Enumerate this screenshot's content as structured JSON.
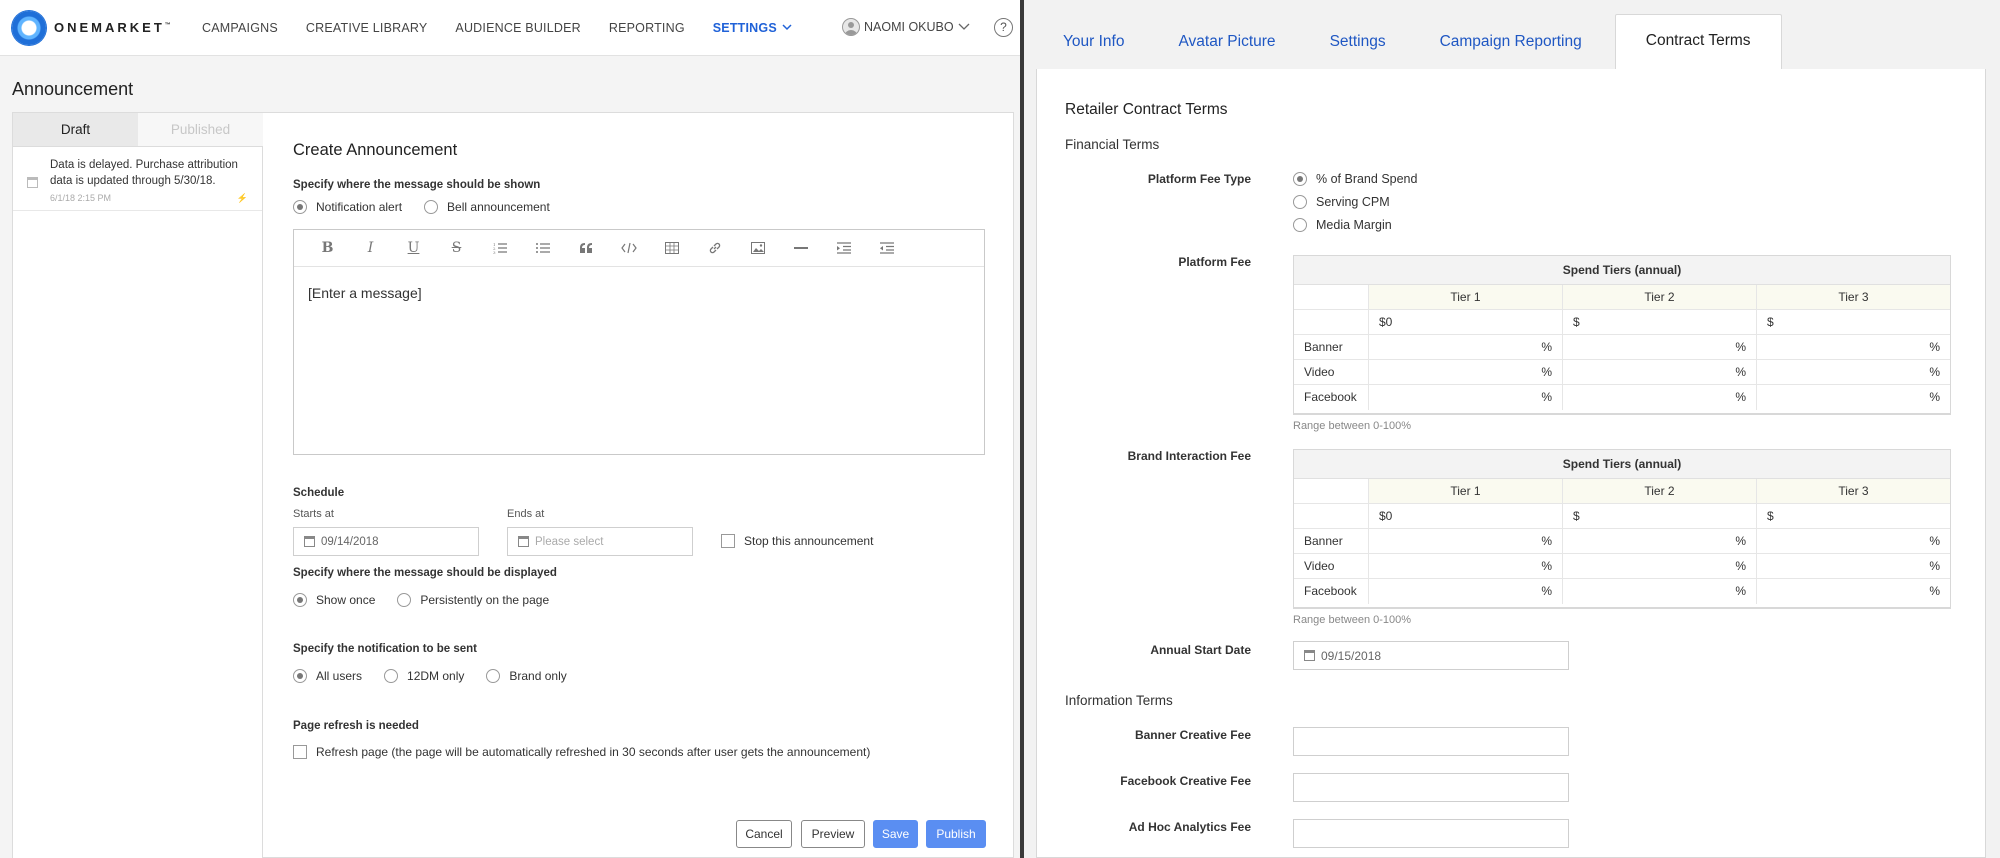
{
  "left": {
    "brand": {
      "name": "ONEMARKET",
      "tm": "™"
    },
    "nav": [
      "CAMPAIGNS",
      "CREATIVE LIBRARY",
      "AUDIENCE BUILDER",
      "REPORTING"
    ],
    "nav_active": "SETTINGS",
    "user_name": "NAOMI OKUBO",
    "help": "?",
    "page_title": "Announcement",
    "tabs": {
      "draft": "Draft",
      "published": "Published"
    },
    "list_items": [
      {
        "text": "Data is delayed. Purchase attribution data is updated through 5/30/18.",
        "date": "6/1/18 2:15 PM",
        "bolt": "⚡"
      }
    ],
    "form": {
      "title": "Create Announcement",
      "where_shown_label": "Specify where the message should be shown",
      "where_shown_options": [
        "Notification alert",
        "Bell announcement"
      ],
      "where_shown_selected": 0,
      "toolbar": [
        "B",
        "I",
        "U",
        "S",
        "ordered-list",
        "bullet-list",
        "quote",
        "code",
        "table",
        "link",
        "image",
        "hr",
        "indent",
        "outdent"
      ],
      "editor_placeholder": "[Enter a message]",
      "schedule_label": "Schedule",
      "starts_label": "Starts at",
      "starts_value": "09/14/2018",
      "ends_label": "Ends at",
      "ends_placeholder": "Please select",
      "stop_label": "Stop this announcement",
      "display_label": "Specify where the message should be displayed",
      "display_options": [
        "Show once",
        "Persistently on the page"
      ],
      "display_selected": 0,
      "notify_label": "Specify the notification to be sent",
      "notify_options": [
        "All users",
        "12DM only",
        "Brand only"
      ],
      "notify_selected": 0,
      "refresh_label": "Page refresh is needed",
      "refresh_option": "Refresh page (the page will be automatically refreshed in 30 seconds after user gets the announcement)",
      "buttons": {
        "cancel": "Cancel",
        "preview": "Preview",
        "save": "Save",
        "publish": "Publish"
      }
    }
  },
  "right": {
    "tabs": [
      "Your Info",
      "Avatar Picture",
      "Settings",
      "Campaign Reporting"
    ],
    "active_tab": "Contract Terms",
    "title": "Retailer Contract Terms",
    "financial_terms": "Financial Terms",
    "platform_fee_type_label": "Platform Fee Type",
    "platform_fee_type_options": [
      "% of Brand Spend",
      "Serving CPM",
      "Media Margin"
    ],
    "platform_fee_type_selected": 0,
    "platform_fee_label": "Platform Fee",
    "brand_interaction_fee_label": "Brand Interaction Fee",
    "tier_table": {
      "header": "Spend Tiers (annual)",
      "tiers": [
        "Tier 1",
        "Tier 2",
        "Tier 3"
      ],
      "amounts": [
        "$0",
        "$",
        "$"
      ],
      "rows": [
        "Banner",
        "Video",
        "Facebook"
      ],
      "unit": "%"
    },
    "range_note": "Range between 0-100%",
    "annual_start_label": "Annual Start Date",
    "annual_start_value": "09/15/2018",
    "information_terms": "Information Terms",
    "info_fields": [
      "Banner Creative Fee",
      "Facebook Creative Fee",
      "Ad Hoc Analytics Fee"
    ]
  },
  "colors": {
    "accent": "#2062d8",
    "primary_button": "#5a8ef2",
    "tab_link": "#1f57c3"
  }
}
